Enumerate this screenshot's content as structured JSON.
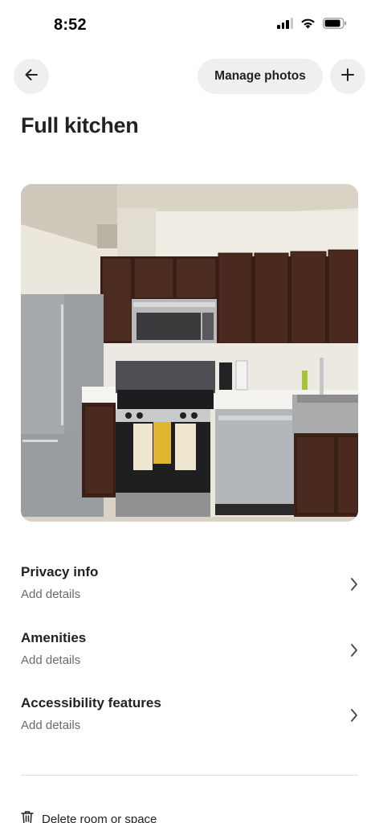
{
  "status_bar": {
    "time": "8:52"
  },
  "nav": {
    "back_icon": "arrow-left-icon",
    "manage_photos_label": "Manage photos",
    "add_icon": "plus-icon"
  },
  "page": {
    "title": "Full kitchen"
  },
  "photo": {
    "subject": "kitchen-photo"
  },
  "sections": [
    {
      "title": "Privacy info",
      "subtitle": "Add details"
    },
    {
      "title": "Amenities",
      "subtitle": "Add details"
    },
    {
      "title": "Accessibility features",
      "subtitle": "Add details"
    }
  ],
  "footer": {
    "delete_label": "Delete room or space",
    "delete_icon": "trash-icon"
  }
}
